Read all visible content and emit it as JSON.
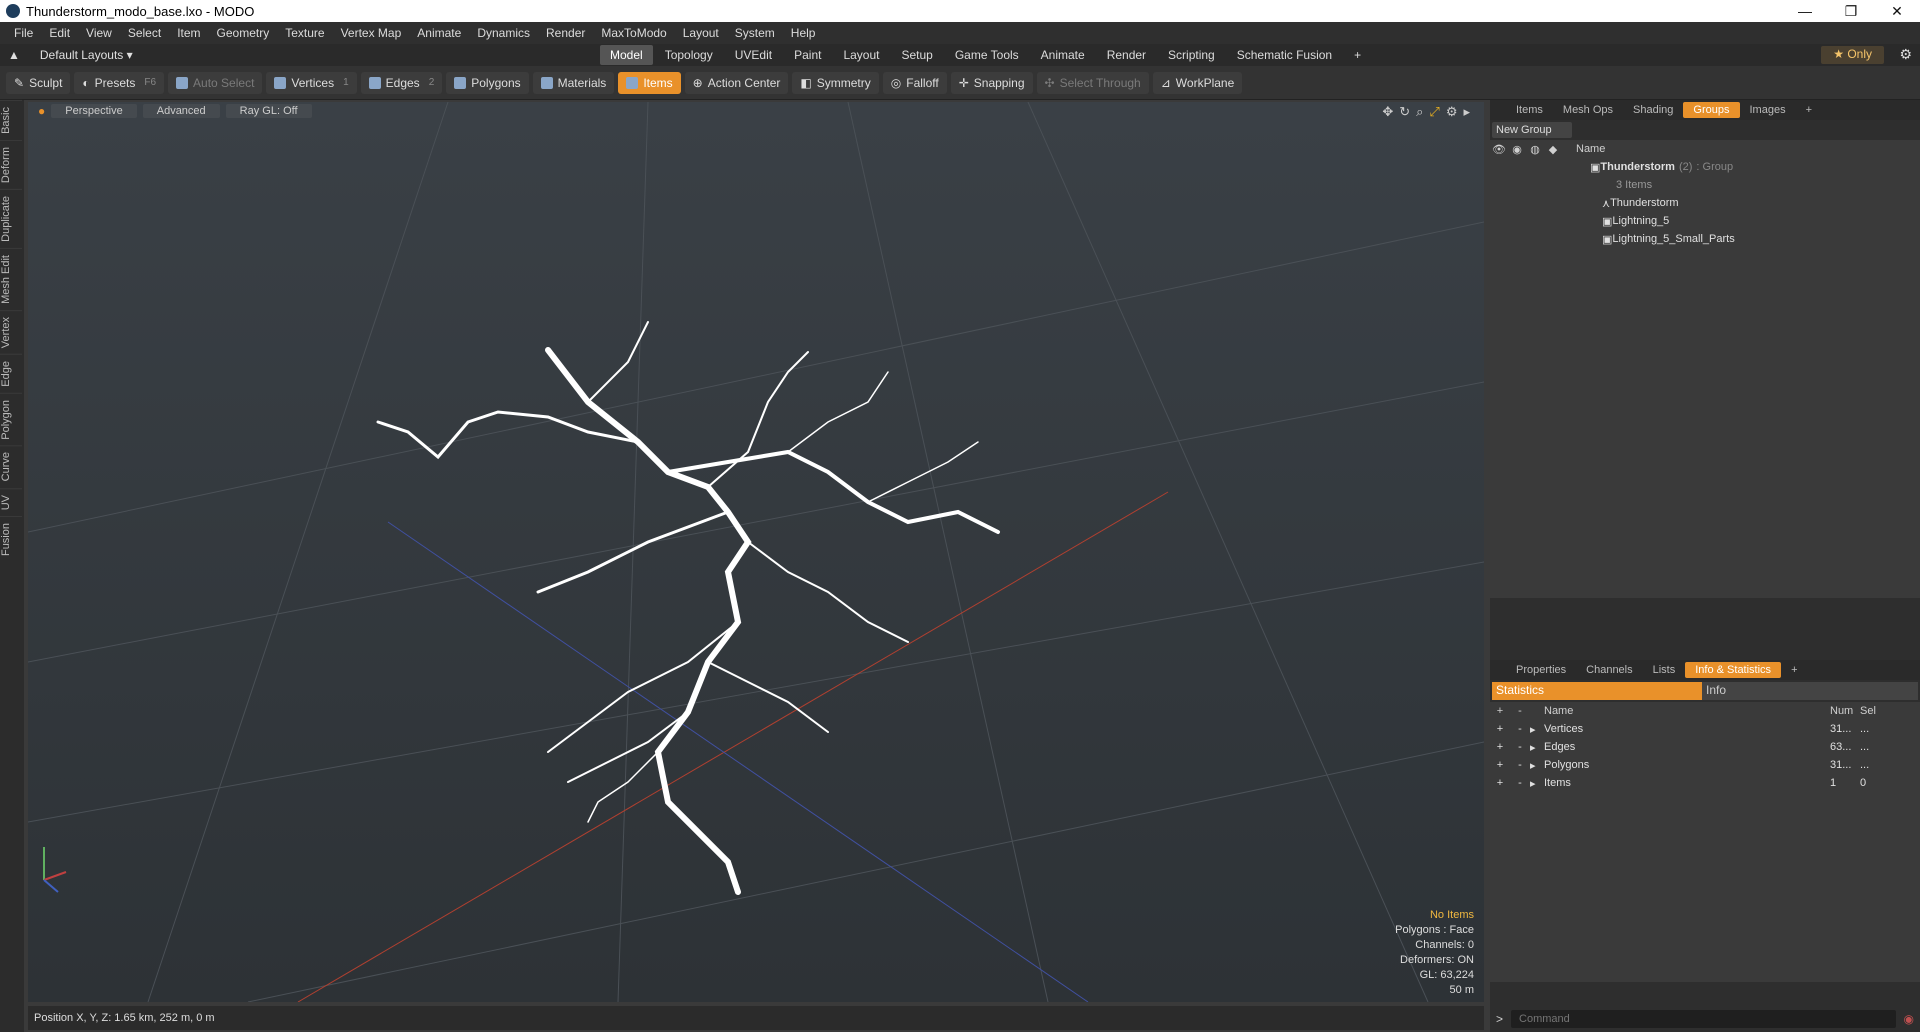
{
  "window": {
    "title": "Thunderstorm_modo_base.lxo - MODO",
    "min": "—",
    "max": "❐",
    "close": "✕"
  },
  "menu": [
    "File",
    "Edit",
    "View",
    "Select",
    "Item",
    "Geometry",
    "Texture",
    "Vertex Map",
    "Animate",
    "Dynamics",
    "Render",
    "MaxToModo",
    "Layout",
    "System",
    "Help"
  ],
  "layouts": {
    "label": "Default Layouts ▾",
    "tabs": [
      "Model",
      "Topology",
      "UVEdit",
      "Paint",
      "Layout",
      "Setup",
      "Game Tools",
      "Animate",
      "Render",
      "Scripting",
      "Schematic Fusion"
    ],
    "active": "Model",
    "add": "+",
    "only": "★ Only"
  },
  "toolbar": [
    {
      "name": "sculpt",
      "label": "Sculpt",
      "hk": ""
    },
    {
      "name": "presets",
      "label": "Presets",
      "hk": "F6"
    },
    {
      "name": "auto-select",
      "label": "Auto Select",
      "hk": "",
      "dim": true
    },
    {
      "name": "vertices",
      "label": "Vertices",
      "hk": "1"
    },
    {
      "name": "edges",
      "label": "Edges",
      "hk": "2"
    },
    {
      "name": "polygons",
      "label": "Polygons",
      "hk": ""
    },
    {
      "name": "materials",
      "label": "Materials",
      "hk": ""
    },
    {
      "name": "items",
      "label": "Items",
      "hk": "",
      "active": true
    },
    {
      "name": "action-center",
      "label": "Action Center",
      "hk": ""
    },
    {
      "name": "symmetry",
      "label": "Symmetry",
      "hk": ""
    },
    {
      "name": "falloff",
      "label": "Falloff",
      "hk": ""
    },
    {
      "name": "snapping",
      "label": "Snapping",
      "hk": ""
    },
    {
      "name": "select-through",
      "label": "Select Through",
      "hk": "",
      "dim": true
    },
    {
      "name": "workplane",
      "label": "WorkPlane",
      "hk": ""
    }
  ],
  "sidetabs": [
    "Basic",
    "Deform",
    "Duplicate",
    "Mesh Edit",
    "Vertex",
    "Edge",
    "Polygon",
    "Curve",
    "UV",
    "Fusion"
  ],
  "viewport": {
    "buttons": [
      "Perspective",
      "Advanced",
      "Ray GL: Off"
    ],
    "info": {
      "selection": "No Items",
      "polygons": "Polygons : Face",
      "channels": "Channels: 0",
      "deformers": "Deformers: ON",
      "gl": "GL: 63,224",
      "scale": "50 m"
    }
  },
  "status": "Position X, Y, Z:  1.65 km, 252 m, 0 m",
  "groups_panel": {
    "tabs": [
      "Items",
      "Mesh Ops",
      "Shading",
      "Groups",
      "Images",
      "+"
    ],
    "active": "Groups",
    "new_group": "New Group",
    "name_col": "Name",
    "group": {
      "name": "Thunderstorm",
      "count": "(2)",
      "type": ": Group",
      "sub": "3 Items"
    },
    "children": [
      "Thunderstorm",
      "Lightning_5",
      "Lightning_5_Small_Parts"
    ]
  },
  "info_panel": {
    "tabs": [
      "Properties",
      "Channels",
      "Lists",
      "Info & Statistics",
      "+"
    ],
    "active": "Info & Statistics",
    "subtabs": [
      "Statistics",
      "Info"
    ],
    "cols": [
      "Name",
      "Num",
      "Sel"
    ],
    "rows": [
      {
        "name": "Vertices",
        "num": "31...",
        "sel": "..."
      },
      {
        "name": "Edges",
        "num": "63...",
        "sel": "..."
      },
      {
        "name": "Polygons",
        "num": "31...",
        "sel": "..."
      },
      {
        "name": "Items",
        "num": "1",
        "sel": "0"
      }
    ]
  },
  "command": {
    "prompt": ">",
    "placeholder": "Command"
  }
}
